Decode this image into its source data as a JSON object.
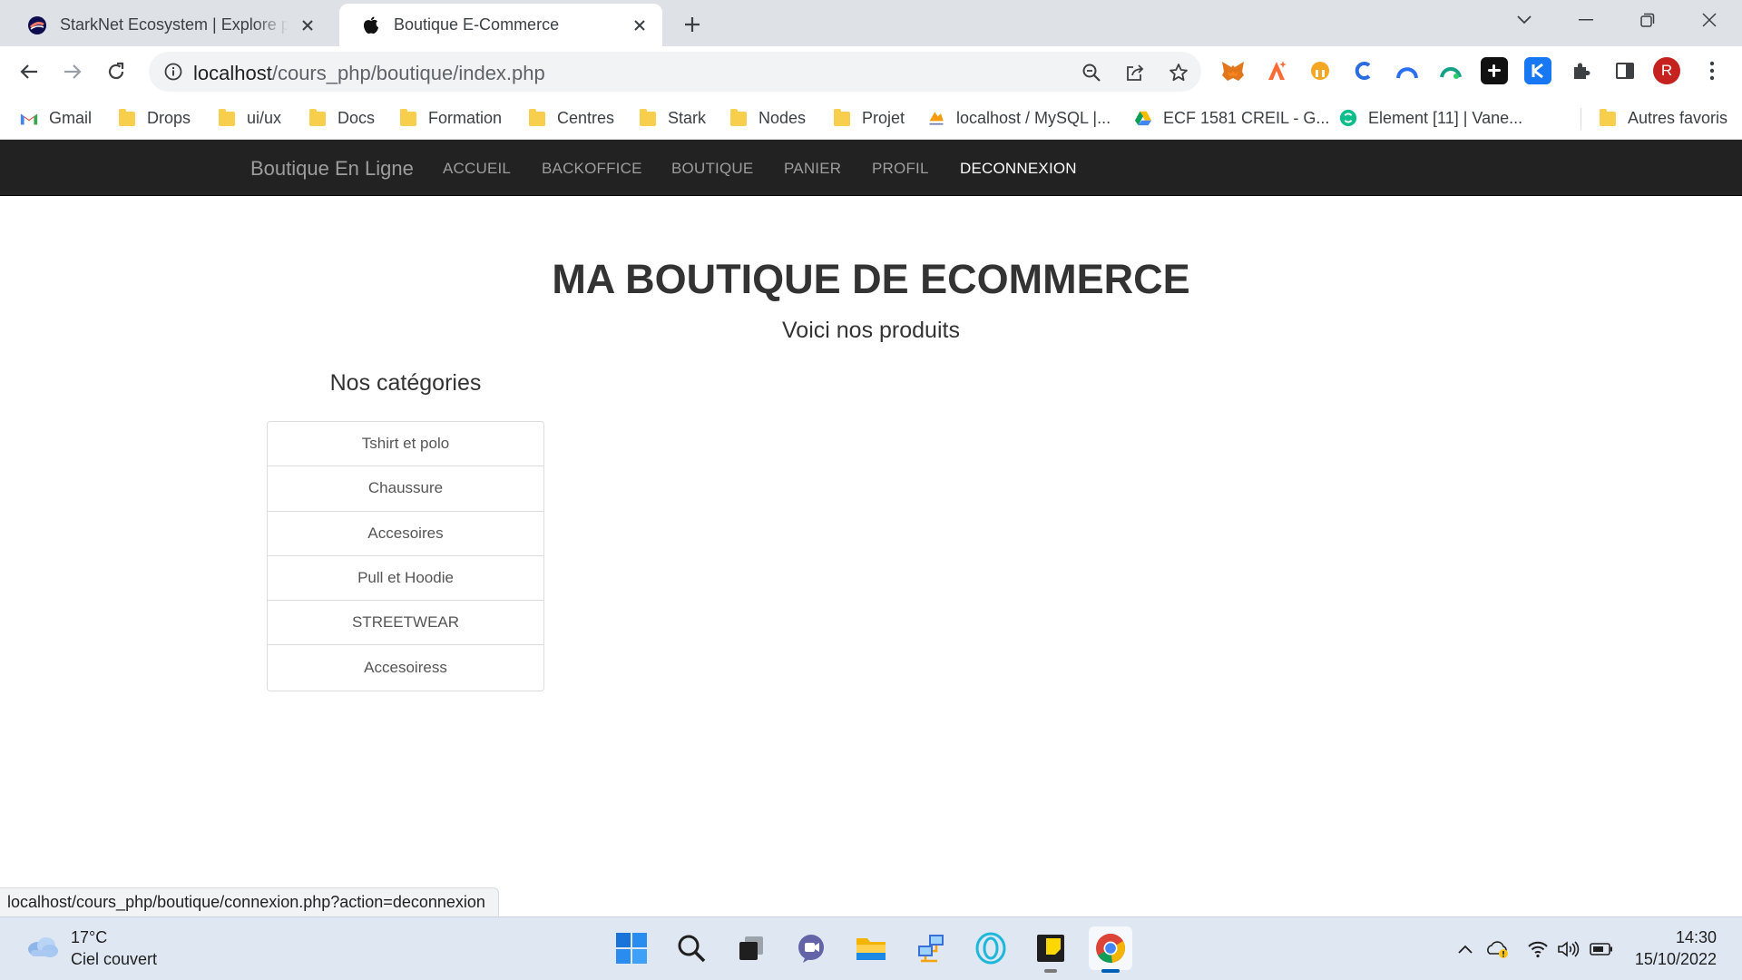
{
  "browser": {
    "tabs": [
      {
        "title": "StarkNet Ecosystem | Explore projects",
        "favicon": "starknet-icon",
        "active": false
      },
      {
        "title": "Boutique E-Commerce",
        "favicon": "apple-icon",
        "active": true
      }
    ],
    "url": {
      "host": "localhost",
      "path": "/cours_php/boutique/index.php"
    },
    "bookmarks": [
      {
        "label": "Gmail",
        "icon": "gmail-icon"
      },
      {
        "label": "Drops",
        "icon": "folder-icon"
      },
      {
        "label": "ui/ux",
        "icon": "folder-icon"
      },
      {
        "label": "Docs",
        "icon": "folder-icon"
      },
      {
        "label": "Formation",
        "icon": "folder-icon"
      },
      {
        "label": "Centres",
        "icon": "folder-icon"
      },
      {
        "label": "Stark",
        "icon": "folder-icon"
      },
      {
        "label": "Nodes",
        "icon": "folder-icon"
      },
      {
        "label": "Projet",
        "icon": "folder-icon"
      },
      {
        "label": "localhost / MySQL |...",
        "icon": "phpmyadmin-icon"
      },
      {
        "label": "ECF 1581 CREIL - G...",
        "icon": "google-drive-icon"
      },
      {
        "label": "Element [11] | Vane...",
        "icon": "element-icon"
      }
    ],
    "other_bookmarks": "Autres favoris",
    "profile_initial": "R",
    "status_url": "localhost/cours_php/boutique/connexion.php?action=deconnexion"
  },
  "site": {
    "brand": "Boutique En Ligne",
    "nav": [
      {
        "label": "ACCUEIL",
        "active": false
      },
      {
        "label": "BACKOFFICE",
        "active": false
      },
      {
        "label": "BOUTIQUE",
        "active": false
      },
      {
        "label": "PANIER",
        "active": false
      },
      {
        "label": "PROFIL",
        "active": false
      },
      {
        "label": "DECONNEXION",
        "active": true
      }
    ],
    "title": "MA BOUTIQUE DE ECOMMERCE",
    "subtitle": "Voici nos produits",
    "categories_heading": "Nos catégories",
    "categories": [
      "Tshirt et polo",
      "Chaussure",
      "Accesoires",
      "Pull et Hoodie",
      "STREETWEAR",
      "Accesoiress"
    ]
  },
  "taskbar": {
    "weather": {
      "temp": "17°C",
      "condition": "Ciel couvert"
    },
    "clock": {
      "time": "14:30",
      "date": "15/10/2022"
    }
  },
  "colors": {
    "navbar_bg": "#222222",
    "navbar_link": "#9d9d9d",
    "navbar_active": "#ffffff"
  }
}
